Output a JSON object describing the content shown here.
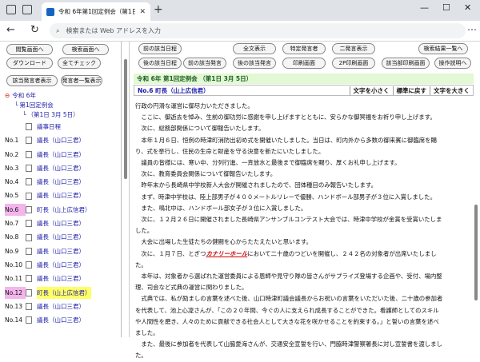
{
  "browser": {
    "tab_title": "令和 6年第1回定例会（第1日 3月 5日）",
    "url_placeholder": "検索または Web アドレスを入力"
  },
  "left": {
    "buttons": [
      "閲覧画面へ",
      "検索画面へ",
      "ダウンロード",
      "全てチェック",
      "該当発言者表示",
      "発言者一覧表示"
    ],
    "tree_root": "令和 6年",
    "tree_session": "第1回定例会",
    "tree_day": "（第1日 3月 5日）",
    "tree_first": "議事日程",
    "rows": [
      {
        "no": "No.1",
        "label": "議長（山口三君）"
      },
      {
        "no": "No.2",
        "label": "議長（山口三君）"
      },
      {
        "no": "No.3",
        "label": "議長（山口三君）"
      },
      {
        "no": "No.4",
        "label": "議長（山口三君）"
      },
      {
        "no": "No.5",
        "label": "議長（山口三君）"
      },
      {
        "no": "No.6",
        "label": "町長（山上広信君）"
      },
      {
        "no": "No.7",
        "label": "議長（山口三君）"
      },
      {
        "no": "No.8",
        "label": "議長（山口三君）"
      },
      {
        "no": "No.9",
        "label": "議長（山口三君）"
      },
      {
        "no": "No.10",
        "label": "議長（山口三君）"
      },
      {
        "no": "No.11",
        "label": "議長（山口三君）"
      },
      {
        "no": "No.12",
        "label": "町長（山上広信君）"
      },
      {
        "no": "No.13",
        "label": "議長（山口三君）"
      },
      {
        "no": "No.14",
        "label": "議長（山口三君）"
      }
    ]
  },
  "right": {
    "buttons": [
      "前の該当日程",
      "全文表示",
      "特定発言者",
      "二発言表示",
      "検索結果一覧へ",
      "後の該当日程",
      "前の該当発言",
      "後の該当発言",
      "印刷画面",
      "2P印刷画面",
      "該当部印刷画面",
      "操作説明へ"
    ],
    "session_title": "令和 6年 第1回定例会 （第1日 3月 5日）",
    "speaker": "No.6 町長（山上広信君）",
    "size_small": "文字を小さく",
    "size_normal": "標準に戻す",
    "size_large": "文字を大きく",
    "lines": [
      "行政の円滑な運営に御尽力いただきました。",
      "　ここに、御逝去を悼み、生前の御功労に感謝を申し上げますとともに、安らかな御冥福をお祈り申し上げます。",
      "　次に、総務部関係について御報告いたします。",
      "　本年１月６日、恒例の時津町消防出初め式を開催いたしました。当日は、町内外から多数の御来賓に御臨席を賜",
      "り、式を挙行し、住民の生命と財産を守る決意を新たにいたしました。",
      "　議員の皆様には、寒い中、分列行進、一斉放水と最後まで御臨席を賜り、厚くお礼申し上げます。",
      "　次に、教育委員会関係について御報告いたします。",
      "　昨年末から長崎県中学校新人大会が開催されましたので、団体種目のみ報告いたします。",
      "　まず、時津中学校は、陸上部男子が４００メートルリレーで優勝、ハンドボール部男子が３位に入賞しました。",
      "　また、鳴北中は、ハンドボール部女子が３位に入賞しました。",
      "　次に、１２月２６日に開催されました長崎県アンサンブルコンテスト大会では、時津中学校が金賞を受賞いたしま",
      "した。",
      "　大会に出場した生徒たちの健闘を心からたたえたいと思います。"
    ],
    "line_pre": "　次に、１月７日、とぎつ",
    "line_red": "カナリーホール",
    "line_post": "において二十歳のつどいを開催し、２４２名の対象者が出席いたしまし",
    "lines2": [
      "た。",
      "　本年は、対象者から選ばれた運営委員による恩師や見守り隊の皆さんがサプライズ登場する企画や、受付、場内整",
      "理、司会など式典の運営に関わりました。",
      "　式典では、私が励ましの言葉を述べた後、山口時津町議会議長からお祝いの言葉をいただいた後、二十歳の参加者",
      "を代表して、池上心凜さんが、「この２０年間、今ぐの人に支えられ成長することができた。看護師としてのスキル",
      "や人間性を磨き、人々のために貢献できる社会人として大きな花を咲かせることを約束する。」と誓いの言葉を述べ",
      "ました。",
      "　また、最後に参加者を代表して山脇愛海さんが、交通安全宣誓を行い、門脇時津警察署長に対し宣誓書を渡しまし",
      "た。"
    ]
  }
}
